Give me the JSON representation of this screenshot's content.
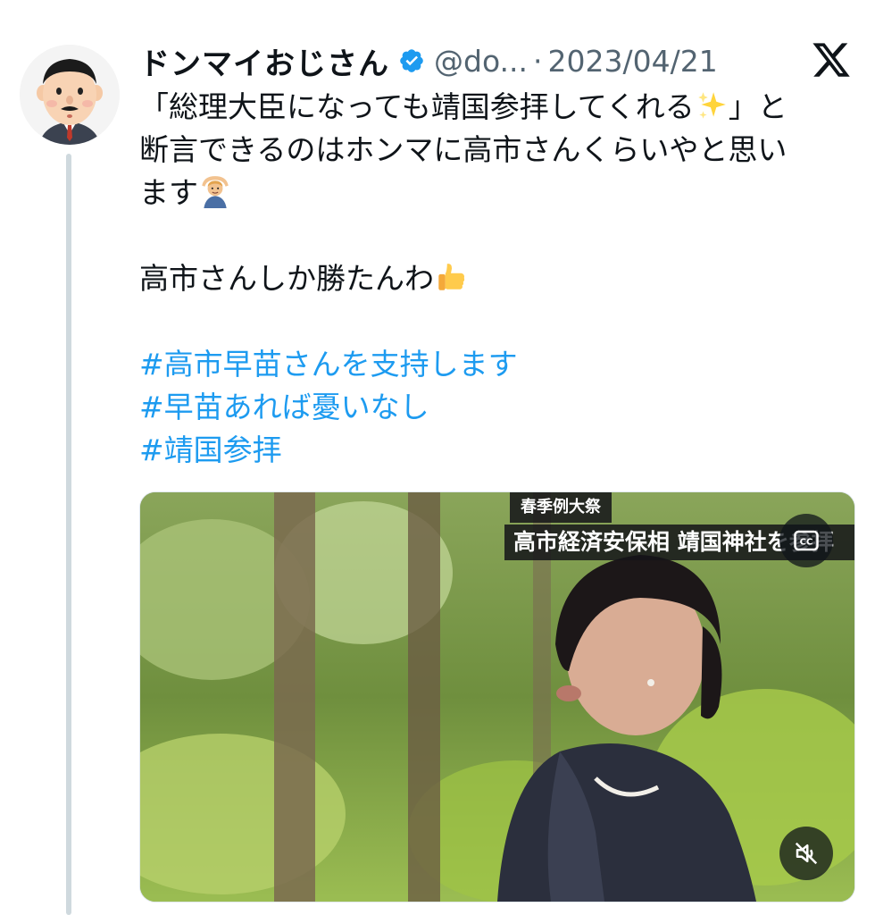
{
  "tweet": {
    "author": {
      "name": "ドンマイおじさん",
      "handle": "@do...",
      "separator": "·",
      "date": "2023/04/21",
      "verified": true,
      "avatar_icon": "cartoon-man-avatar"
    },
    "platform_icon": "x-logo-icon",
    "text": {
      "line1": "「総理大臣になっても靖国参拝してくれる",
      "line1_after_emoji": "」と",
      "line2": "断言できるのはホンマに高市さんくらいやと思い",
      "line3": "ます",
      "line4": "高市さんしか勝たんわ",
      "emojis": [
        "sparkles-emoji",
        "person-gesturing-ok-emoji",
        "thumbs-up-emoji"
      ]
    },
    "hashtags": [
      "#高市早苗さんを支持します",
      "#早苗あれば憂いなし",
      "#靖国参拝"
    ],
    "media": {
      "caption_top": "春季例大祭",
      "caption_main": "高市経済安保相 靖国神社を参拝",
      "cc_icon": "closed-captions-icon",
      "mute_icon": "muted-speaker-icon"
    }
  },
  "colors": {
    "text": "#0f1419",
    "secondary": "#536471",
    "hashtag": "#1d9bf0",
    "verified": "#1d9bf0",
    "thread_line": "#cfd9de"
  }
}
